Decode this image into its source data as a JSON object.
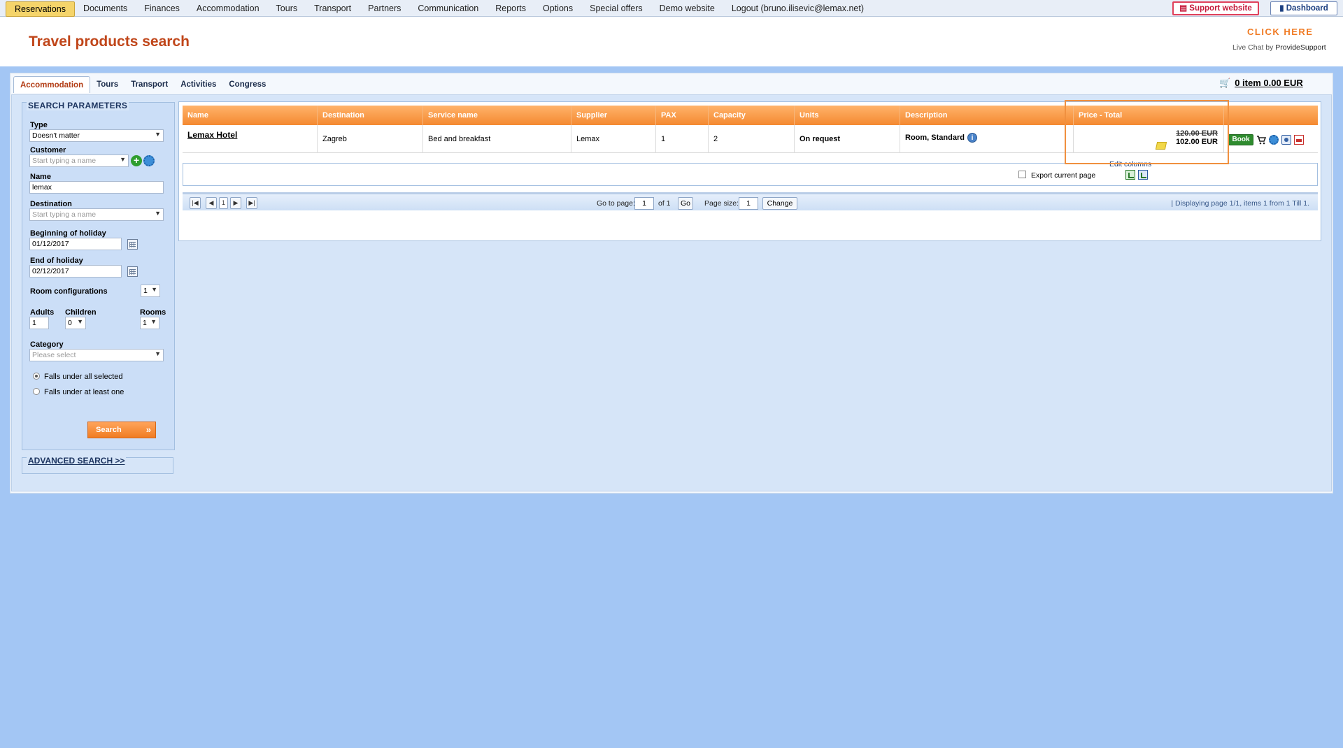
{
  "topnav": {
    "items": [
      "Reservations",
      "Documents",
      "Finances",
      "Accommodation",
      "Tours",
      "Transport",
      "Partners",
      "Communication",
      "Reports",
      "Options",
      "Special offers",
      "Demo website",
      "Logout (bruno.ilisevic@lemax.net)"
    ],
    "active": "Reservations",
    "support_label": "Support website",
    "dashboard_label": "Dashboard"
  },
  "header": {
    "title": "Travel products search",
    "click_here": "CLICK HERE",
    "livechat_prefix": "Live Chat by",
    "livechat_brand": "ProvideSupport"
  },
  "tabs": [
    "Accommodation",
    "Tours",
    "Transport",
    "Activities",
    "Congress"
  ],
  "cart": {
    "count_text": "0 item 0.00 EUR"
  },
  "search": {
    "legend": "SEARCH PARAMETERS",
    "type_label": "Type",
    "type_value": "Doesn't matter",
    "customer_label": "Customer",
    "customer_placeholder": "Start typing a name",
    "name_label": "Name",
    "name_value": "lemax",
    "destination_label": "Destination",
    "destination_placeholder": "Start typing a name",
    "begin_label": "Beginning of holiday",
    "begin_value": "01/12/2017",
    "end_label": "End of holiday",
    "end_value": "02/12/2017",
    "room_config_label": "Room configurations",
    "room_config_value": "1",
    "adults_label": "Adults",
    "adults_value": "1",
    "children_label": "Children",
    "children_value": "0",
    "rooms_label": "Rooms",
    "rooms_value": "1",
    "category_label": "Category",
    "category_placeholder": "Please select",
    "radio_all": "Falls under all selected",
    "radio_one": "Falls under at least one",
    "button": "Search",
    "advanced": "ADVANCED SEARCH >>"
  },
  "grid": {
    "columns": [
      "Name",
      "Destination",
      "Service name",
      "Supplier",
      "PAX",
      "Capacity",
      "Units",
      "Description",
      "Price - Total"
    ],
    "rows": [
      {
        "name": "Lemax Hotel",
        "destination": "Zagreb",
        "service": "Bed and breakfast",
        "supplier": "Lemax",
        "pax": "1",
        "capacity": "2",
        "units": "On request",
        "description": "Room, Standard",
        "price_old": "120.00 EUR",
        "price_new": "102.00 EUR",
        "book_label": "Book"
      }
    ],
    "edit_columns": "Edit columns",
    "export_label": "Export current page"
  },
  "pager": {
    "current_page": "1",
    "goto_label": "Go to page:",
    "goto_value": "1",
    "of_label": "of 1",
    "go_label": "Go",
    "page_size_label": "Page size:",
    "page_size_value": "1",
    "change_label": "Change",
    "info": "| Displaying page  1/1,  items  1  from  1  Till  1."
  },
  "colors": {
    "accent_orange": "#f48931",
    "title_red": "#c0461a",
    "bg_blue": "#a3c6f4"
  }
}
